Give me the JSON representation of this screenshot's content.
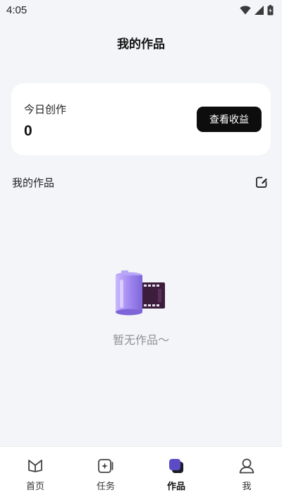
{
  "status_bar": {
    "time": "4:05",
    "icons": [
      "wifi-icon",
      "signal-icon",
      "battery-icon"
    ]
  },
  "page": {
    "title": "我的作品"
  },
  "stats_card": {
    "label": "今日创作",
    "value": "0",
    "button_label": "查看收益"
  },
  "section": {
    "title": "我的作品",
    "action_icon": "edit-icon"
  },
  "empty_state": {
    "icon": "film-roll-icon",
    "text": "暂无作品～"
  },
  "tab_bar": {
    "items": [
      {
        "label": "首页",
        "icon": "home-icon",
        "active": false
      },
      {
        "label": "任务",
        "icon": "task-icon",
        "active": false
      },
      {
        "label": "作品",
        "icon": "works-icon",
        "active": true
      },
      {
        "label": "我",
        "icon": "profile-icon",
        "active": false
      }
    ]
  },
  "colors": {
    "background": "#f4f5f9",
    "card": "#ffffff",
    "button": "#0d0d0d",
    "accent_purple": "#5b4bc4",
    "muted_text": "#8f9097"
  }
}
